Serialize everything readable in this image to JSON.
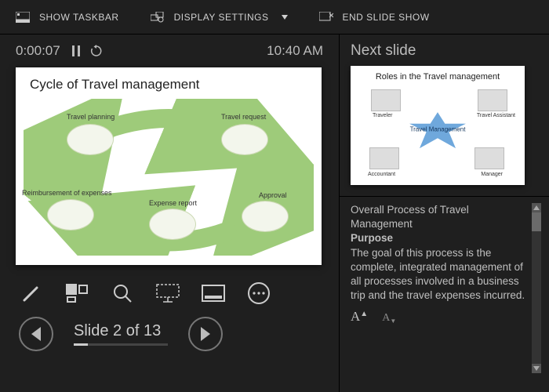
{
  "topbar": {
    "show_taskbar": "SHOW TASKBAR",
    "display_settings": "DISPLAY SETTINGS",
    "end_slide_show": "END SLIDE SHOW"
  },
  "timer": {
    "elapsed": "0:00:07",
    "clock": "10:40 AM"
  },
  "current_slide": {
    "title": "Cycle of Travel management",
    "nodes": {
      "travel_planning": "Travel planning",
      "travel_request": "Travel request",
      "approval": "Approval",
      "expense_report": "Expense report",
      "reimbursement": "Reimbursement of expenses"
    }
  },
  "nav": {
    "counter": "Slide 2 of 13"
  },
  "next": {
    "heading": "Next slide",
    "title": "Roles in the Travel management",
    "center": "Travel Management",
    "roles": {
      "traveler": "Traveler",
      "travel_assistant": "Travel Assistant",
      "manager": "Manager",
      "accountant": "Accountant"
    }
  },
  "notes": {
    "title_line": "Overall Process of Travel Management",
    "purpose_label": "Purpose",
    "body": "The goal of this process is the complete, integrated management of all processes involved in a business trip and the travel expenses incurred."
  }
}
